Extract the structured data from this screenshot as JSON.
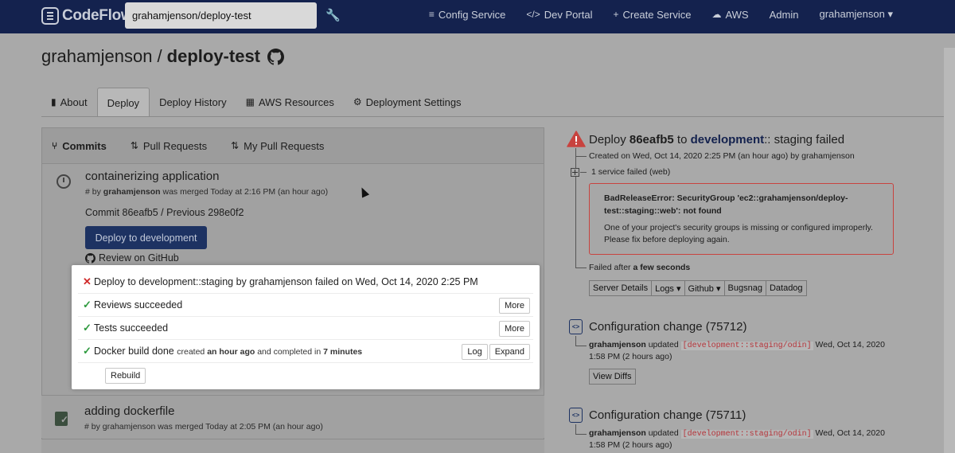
{
  "navbar": {
    "logo": "CodeFlow",
    "repo_value": "grahamjenson/deploy-test",
    "links": [
      {
        "icon": "≡",
        "label": "Config Service"
      },
      {
        "icon": "</>",
        "label": "Dev Portal"
      },
      {
        "icon": "+",
        "label": "Create Service"
      },
      {
        "icon": "☁",
        "label": "AWS"
      },
      {
        "icon": "",
        "label": "Admin"
      },
      {
        "icon": "",
        "label": "grahamjenson ▾"
      }
    ]
  },
  "page": {
    "owner": "grahamjenson /",
    "repo": "deploy-test"
  },
  "tabs": [
    {
      "icon": "▮",
      "label": "About"
    },
    {
      "icon": "",
      "label": "Deploy"
    },
    {
      "icon": "",
      "label": "Deploy History"
    },
    {
      "icon": "▦",
      "label": "AWS Resources"
    },
    {
      "icon": "⚙",
      "label": "Deployment Settings"
    }
  ],
  "subtabs": [
    {
      "label": "Commits"
    },
    {
      "label": "Pull Requests"
    },
    {
      "label": "My Pull Requests"
    }
  ],
  "commit1": {
    "title": "containerizing application",
    "meta_prefix": "# by",
    "author": "grahamjenson",
    "meta_suffix": "was merged Today at 2:16 PM (an hour ago)",
    "commit_line": "Commit 86eafb5 / Previous 298e0f2",
    "deploy_button": "Deploy to development",
    "review_link": "Review on GitHub"
  },
  "status": {
    "fail_text": "Deploy to development::staging by grahamjenson failed on Wed, Oct 14, 2020 2:25 PM",
    "reviews": "Reviews succeeded",
    "tests": "Tests succeeded",
    "docker": "Docker build done",
    "docker_created": "created",
    "docker_ago": "an hour ago",
    "docker_completed": "and completed in",
    "docker_duration": "7 minutes",
    "more_label": "More",
    "log_label": "Log",
    "expand_label": "Expand",
    "rebuild_label": "Rebuild"
  },
  "commit2": {
    "title": "adding dockerfile",
    "meta": "# by grahamjenson was merged Today at 2:05 PM (an hour ago)"
  },
  "deploy_result": {
    "prefix": "Deploy",
    "sha": "86eafb5",
    "to": "to",
    "env": "development",
    "suffix": ":: staging failed",
    "created": "Created on Wed, Oct 14, 2020 2:25 PM (an hour ago) by grahamjenson",
    "services_failed": "1 service failed (web)",
    "error_title": "BadReleaseError: SecurityGroup 'ec2::grahamjenson/deploy-test::staging::web': not found",
    "error_body": "One of your project's security groups is missing or configured improperly. Please fix before deploying again.",
    "failed_after_prefix": "Failed after",
    "failed_after_value": "a few seconds",
    "buttons": [
      "Server Details",
      "Logs ▾",
      "Github ▾",
      "Bugsnag",
      "Datadog"
    ]
  },
  "config_changes": [
    {
      "title": "Configuration change (75712)",
      "user": "grahamjenson",
      "action": "updated",
      "env_tag": "[development::staging/odin]",
      "date": "Wed, Oct 14, 2020",
      "time": "1:58 PM (2 hours ago)",
      "button": "View Diffs"
    },
    {
      "title": "Configuration change (75711)",
      "user": "grahamjenson",
      "action": "updated",
      "env_tag": "[development::staging/odin]",
      "date": "Wed, Oct 14, 2020",
      "time": "1:58 PM (2 hours ago)"
    }
  ],
  "colors": {
    "navbar": "#14224e",
    "primary_button": "#1d3262",
    "error": "#c8433f",
    "success": "#2e9a3e"
  }
}
